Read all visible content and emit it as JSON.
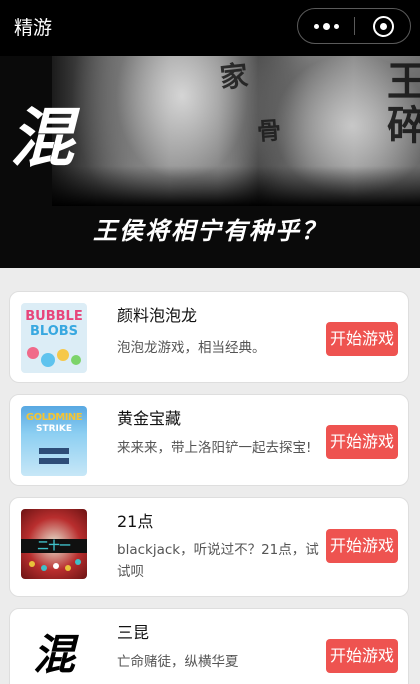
{
  "nav": {
    "title": "精游",
    "more_icon": "more-dots-icon",
    "close_icon": "target-close-icon"
  },
  "banner": {
    "side_char": "混",
    "tattoo_1": "家",
    "tattoo_2": "骨",
    "tattoo_3": "王碎",
    "slogan": "王侯将相宁有种乎？"
  },
  "games": [
    {
      "name": "颜料泡泡龙",
      "desc": "泡泡龙游戏，相当经典。",
      "button": "开始游戏",
      "thumb_line1": "BUBBLE",
      "thumb_line2": "BLOBS"
    },
    {
      "name": "黄金宝藏",
      "desc": "来来来，带上洛阳铲一起去探宝!",
      "button": "开始游戏",
      "thumb_line1": "GOLDMINE",
      "thumb_line2": "STRIKE"
    },
    {
      "name": "21点",
      "desc": "blackjack，听说过不？21点，试试呗",
      "button": "开始游戏",
      "thumb_line1": "二十一"
    },
    {
      "name": "三昆",
      "desc": "亡命赌徒，纵横华夏",
      "button": "开始游戏",
      "thumb_line1": "混"
    }
  ],
  "colors": {
    "accent": "#ee5350",
    "nav_bg": "#000000",
    "page_bg": "#ececec"
  }
}
